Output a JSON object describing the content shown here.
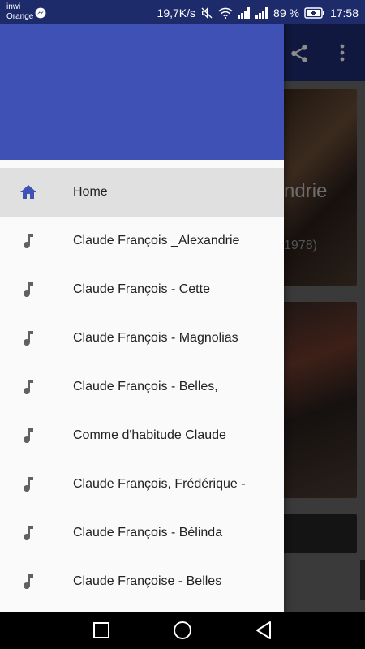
{
  "status_bar": {
    "carrier_line1": "inwi",
    "carrier_line2": "Orange",
    "speed": "19,7K/s",
    "battery": "89 %",
    "time": "17:58",
    "icons": [
      "messenger-icon",
      "mute-icon",
      "wifi-icon",
      "signal-icon",
      "signal-icon",
      "battery-charging-icon"
    ]
  },
  "app_bar": {
    "actions": [
      "share-icon",
      "more-vert-icon"
    ]
  },
  "background_content": {
    "card1_title_fragment": "ndrie",
    "card1_subtitle_fragment": "1978)"
  },
  "drawer": {
    "header_color": "#3f51b5",
    "items": [
      {
        "label": "Home",
        "icon": "home-icon",
        "active": true
      },
      {
        "label": "Claude François _Alexandrie",
        "icon": "music-note-icon"
      },
      {
        "label": "Claude François - Cette",
        "icon": "music-note-icon"
      },
      {
        "label": "Claude François - Magnolias",
        "icon": "music-note-icon"
      },
      {
        "label": "Claude François - Belles,",
        "icon": "music-note-icon"
      },
      {
        "label": "Comme d'habitude Claude",
        "icon": "music-note-icon"
      },
      {
        "label": "Claude François, Frédérique -",
        "icon": "music-note-icon"
      },
      {
        "label": "Claude François - Bélinda",
        "icon": "music-note-icon"
      },
      {
        "label": "Claude Françoise - Belles",
        "icon": "music-note-icon"
      }
    ]
  },
  "nav_bar": {
    "buttons": [
      "recents-square-icon",
      "home-circle-icon",
      "back-triangle-icon"
    ]
  }
}
